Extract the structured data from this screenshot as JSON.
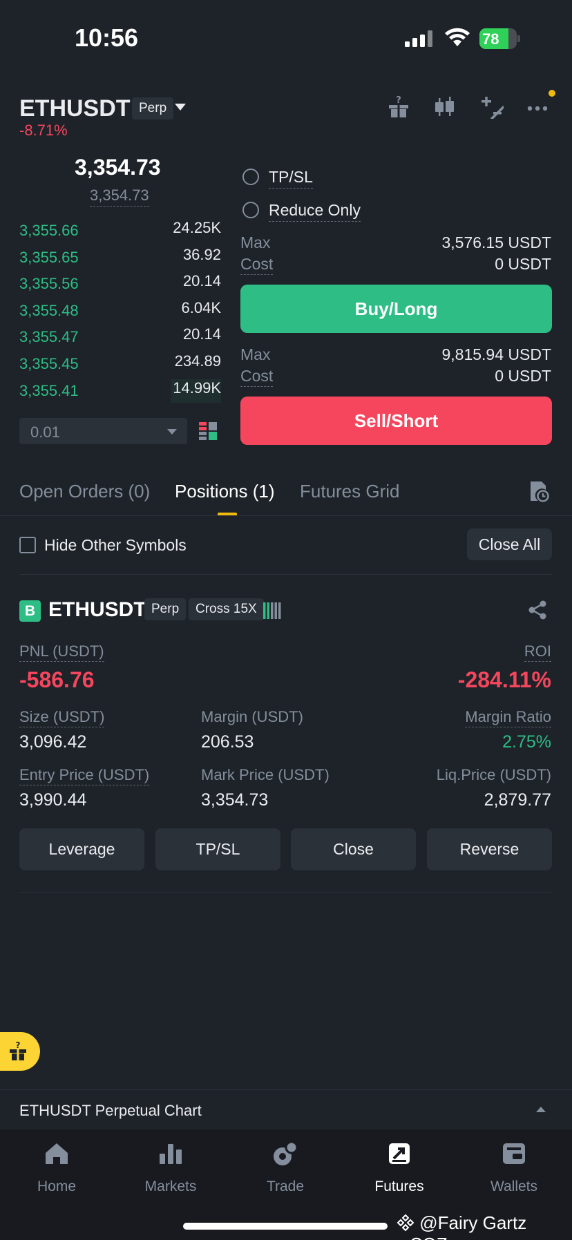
{
  "status_bar": {
    "time": "10:56",
    "battery": "78",
    "battery_level": 0.78
  },
  "header": {
    "symbol": "ETHUSDT",
    "type_badge": "Perp",
    "change": "-8.71%"
  },
  "order_book": {
    "last_price": "3,354.73",
    "mark_price": "3,354.73",
    "rows": [
      {
        "price": "3,355.66",
        "qty": "24.25K",
        "depth": 0.0
      },
      {
        "price": "3,355.65",
        "qty": "36.92",
        "depth": 0.0
      },
      {
        "price": "3,355.56",
        "qty": "20.14",
        "depth": 0.0
      },
      {
        "price": "3,355.48",
        "qty": "6.04K",
        "depth": 0.0
      },
      {
        "price": "3,355.47",
        "qty": "20.14",
        "depth": 0.0
      },
      {
        "price": "3,355.45",
        "qty": "234.89",
        "depth": 0.0
      },
      {
        "price": "3,355.41",
        "qty": "14.99K",
        "depth": 0.25
      }
    ],
    "precision": "0.01"
  },
  "order_form": {
    "tpsl_label": "TP/SL",
    "reduce_only_label": "Reduce Only",
    "buy": {
      "max_label": "Max",
      "max_value": "3,576.15 USDT",
      "cost_label": "Cost",
      "cost_value": "0 USDT",
      "button": "Buy/Long"
    },
    "sell": {
      "max_label": "Max",
      "max_value": "9,815.94 USDT",
      "cost_label": "Cost",
      "cost_value": "0 USDT",
      "button": "Sell/Short"
    }
  },
  "tabs": [
    "Open Orders (0)",
    "Positions (1)",
    "Futures Grid"
  ],
  "positions": {
    "hide_other_label": "Hide Other Symbols",
    "close_all": "Close All",
    "item": {
      "side_badge": "B",
      "symbol": "ETHUSDT",
      "type_badge": "Perp",
      "margin_badge": "Cross 15X",
      "pnl_label": "PNL (USDT)",
      "pnl_value": "-586.76",
      "roi_label": "ROI",
      "roi_value": "-284.11%",
      "size_label": "Size (USDT)",
      "size_value": "3,096.42",
      "margin_label": "Margin (USDT)",
      "margin_value": "206.53",
      "margin_ratio_label": "Margin Ratio",
      "margin_ratio_value": "2.75%",
      "entry_label": "Entry Price (USDT)",
      "entry_value": "3,990.44",
      "mark_label": "Mark Price (USDT)",
      "mark_value": "3,354.73",
      "liq_label": "Liq.Price (USDT)",
      "liq_value": "2,879.77",
      "actions": [
        "Leverage",
        "TP/SL",
        "Close",
        "Reverse"
      ]
    }
  },
  "chart_bar": {
    "label": "ETHUSDT Perpetual  Chart"
  },
  "nav": [
    "Home",
    "Markets",
    "Trade",
    "Futures",
    "Wallets"
  ],
  "watermark": "@Fairy Gartz wCOZ",
  "colors": {
    "bg": "#1e2329",
    "green": "#2ebd85",
    "red": "#f6465d",
    "yellow": "#f0b90b"
  }
}
